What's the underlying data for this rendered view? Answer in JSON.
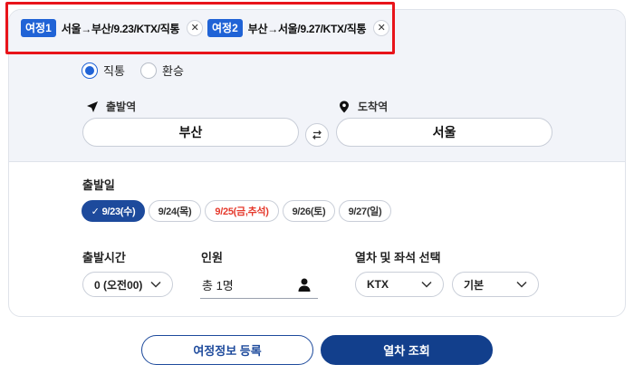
{
  "trips": [
    {
      "badge": "여정1",
      "text": "서울→부산/9.23/KTX/직통",
      "close": "✕"
    },
    {
      "badge": "여정2",
      "text": "부산→서울/9.27/KTX/직통",
      "close": "✕"
    }
  ],
  "route_type": {
    "options": [
      {
        "label": "직통",
        "selected": true
      },
      {
        "label": "환승",
        "selected": false
      }
    ]
  },
  "stations": {
    "departure_label": "출발역",
    "departure_value": "부산",
    "arrival_label": "도착역",
    "arrival_value": "서울"
  },
  "date": {
    "label": "출발일",
    "options": [
      {
        "label": "9/23(수)",
        "selected": true,
        "check": "✓"
      },
      {
        "label": "9/24(목)"
      },
      {
        "label": "9/25(금,추석)",
        "holiday": true
      },
      {
        "label": "9/26(토)"
      },
      {
        "label": "9/27(일)"
      }
    ]
  },
  "time": {
    "label": "출발시간",
    "value": "0 (오전00)"
  },
  "passengers": {
    "label": "인원",
    "value": "총 1명"
  },
  "train": {
    "label": "열차 및 좌석 선택",
    "train_value": "KTX",
    "seat_value": "기본"
  },
  "actions": {
    "register_label": "여정정보 등록",
    "search_label": "열차 조회"
  },
  "colors": {
    "accent": "#2063d6",
    "primary": "#123f8c",
    "holiday": "#e53a2d",
    "highlight": "#e8141a"
  }
}
